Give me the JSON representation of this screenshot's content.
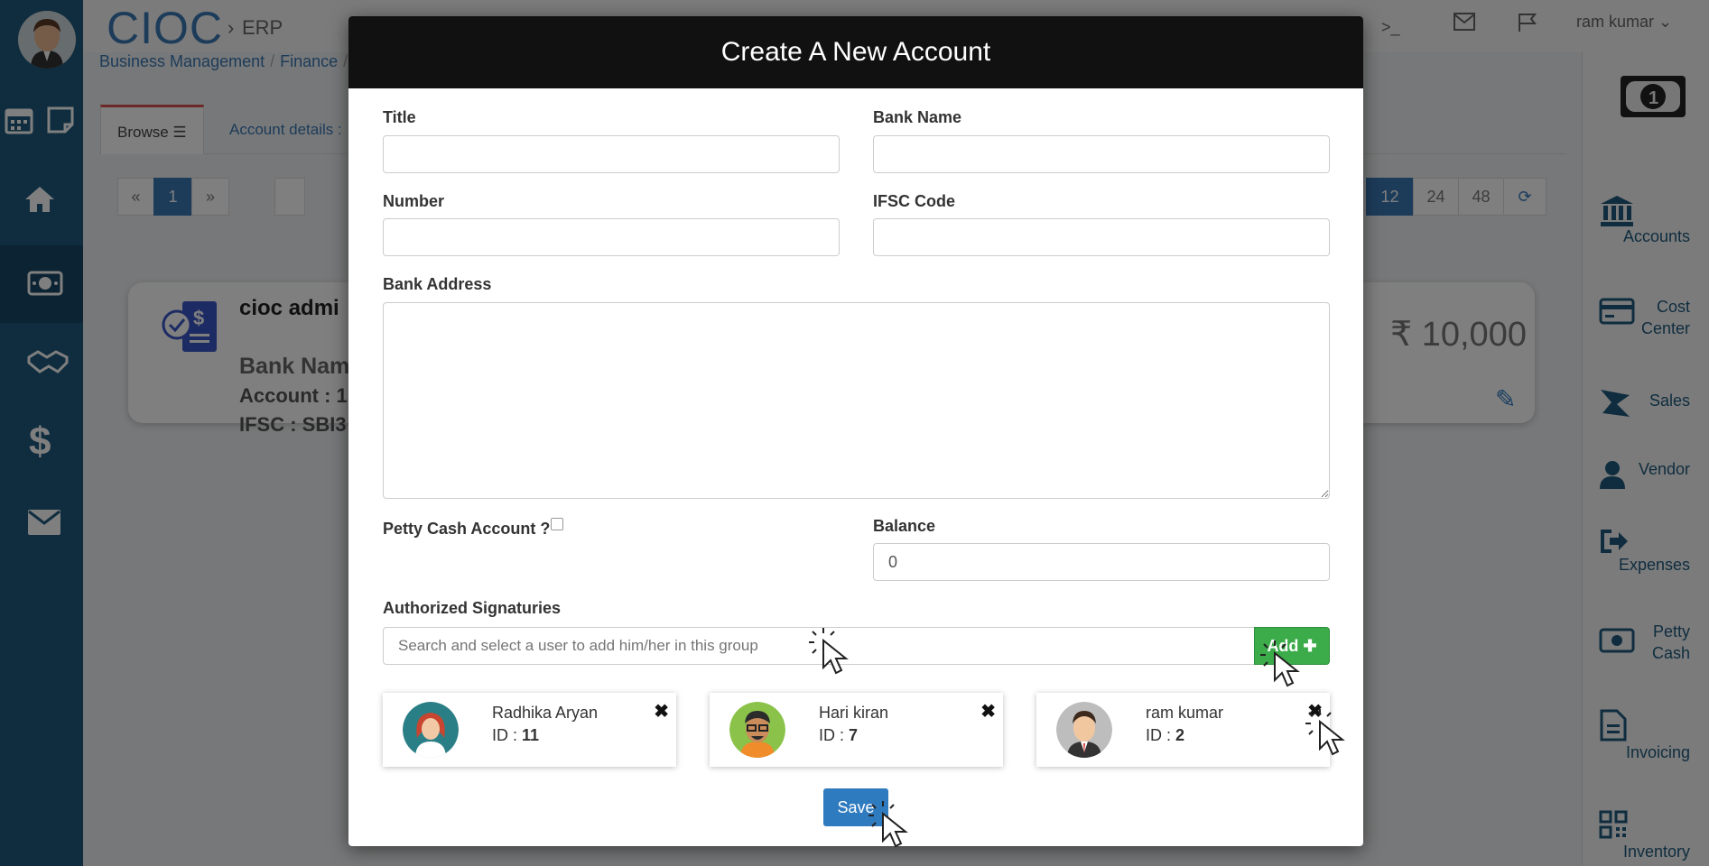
{
  "app": {
    "brand": "CIOC",
    "brand_sub": "ERP",
    "user_name": "ram kumar"
  },
  "breadcrumb": [
    "Business Management",
    "Finance"
  ],
  "tabs": {
    "browse": "Browse",
    "account_details": "Account details :"
  },
  "pagination": {
    "prev": "«",
    "current": "1",
    "next": "»",
    "page_sizes": [
      "12",
      "24",
      "48"
    ]
  },
  "account_card": {
    "title": "cioc admi",
    "bank_name_label": "Bank Nam",
    "account_line": "Account : 1",
    "ifsc_line": "IFSC : SBI3",
    "amount": "₹ 10,000"
  },
  "right_sidebar": {
    "items": [
      {
        "label": "Accounts",
        "icon": "bank-icon"
      },
      {
        "label": "Cost Center",
        "icon": "credit-card-icon"
      },
      {
        "label": "Sales",
        "icon": "sales-icon"
      },
      {
        "label": "Vendor",
        "icon": "user-icon"
      },
      {
        "label": "Expenses",
        "icon": "sign-out-icon"
      },
      {
        "label": "Petty Cash",
        "icon": "money-icon"
      },
      {
        "label": "Invoicing",
        "icon": "file-icon"
      },
      {
        "label": "Inventory",
        "icon": "qr-icon"
      }
    ]
  },
  "modal": {
    "title": "Create A New Account",
    "title_label": "Title",
    "title_value": "",
    "bank_name_label": "Bank Name",
    "bank_name_value": "",
    "number_label": "Number",
    "number_value": "",
    "ifsc_label": "IFSC Code",
    "ifsc_value": "",
    "bank_address_label": "Bank Address",
    "bank_address_value": "",
    "petty_cash_label": "Petty Cash Account ?",
    "petty_cash_checked": false,
    "balance_label": "Balance",
    "balance_value": "0",
    "authorized_label": "Authorized Signaturies",
    "search_placeholder": "Search and select a user to add him/her in this group",
    "add_label": "Add",
    "save_label": "Save",
    "signatories": [
      {
        "name": "Radhika Aryan",
        "id_prefix": "ID : ",
        "id": "11"
      },
      {
        "name": "Hari kiran",
        "id_prefix": "ID : ",
        "id": "7"
      },
      {
        "name": "ram kumar",
        "id_prefix": "ID : ",
        "id": "2"
      }
    ]
  },
  "colors": {
    "primary": "#3a78b5",
    "sidebar": "#1f5a7e",
    "add_button": "#3cab4a",
    "save_button": "#2f7bbf",
    "modal_header": "#111111"
  }
}
